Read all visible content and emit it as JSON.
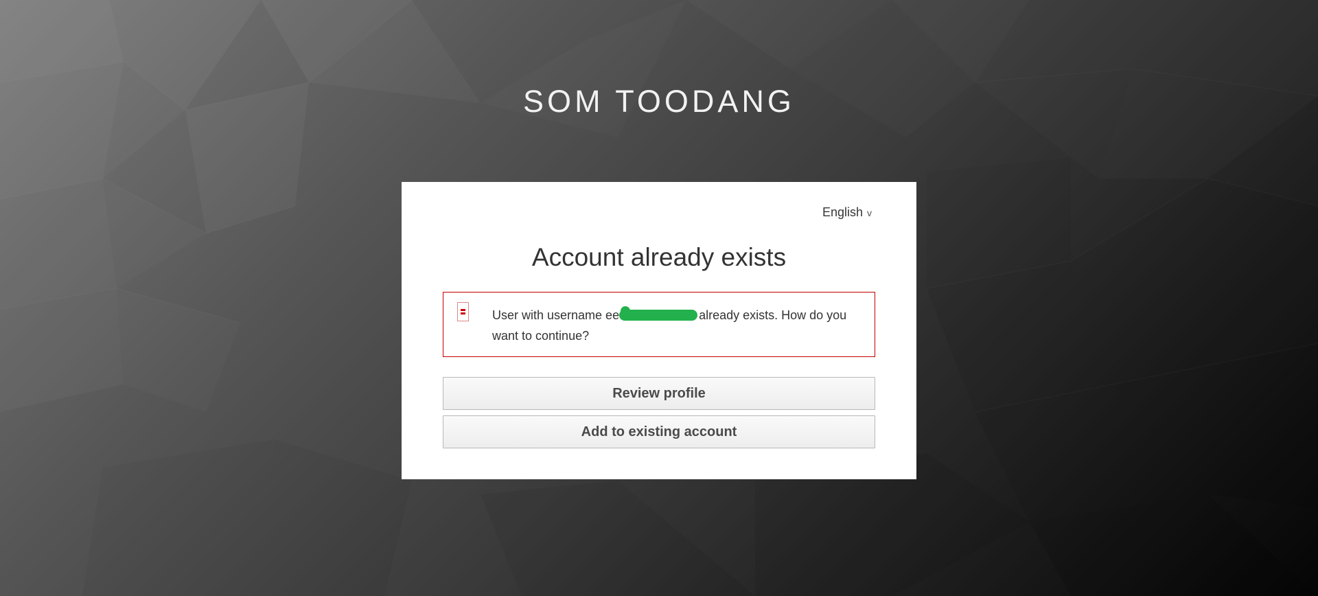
{
  "realm": {
    "title": "SOM TOODANG"
  },
  "locale": {
    "current": "English",
    "chevron": "v"
  },
  "card": {
    "title": "Account already exists"
  },
  "alert": {
    "type": "error",
    "icon": "error-icon",
    "message_prefix": "User with username ee",
    "message_suffix": "already exists. How do you want to continue?",
    "redaction_color": "#22b14c"
  },
  "actions": {
    "review_profile": "Review profile",
    "add_to_existing": "Add to existing account"
  },
  "colors": {
    "alert_border": "#c00000",
    "card_background": "#ffffff",
    "button_text": "#4a4a4a"
  }
}
